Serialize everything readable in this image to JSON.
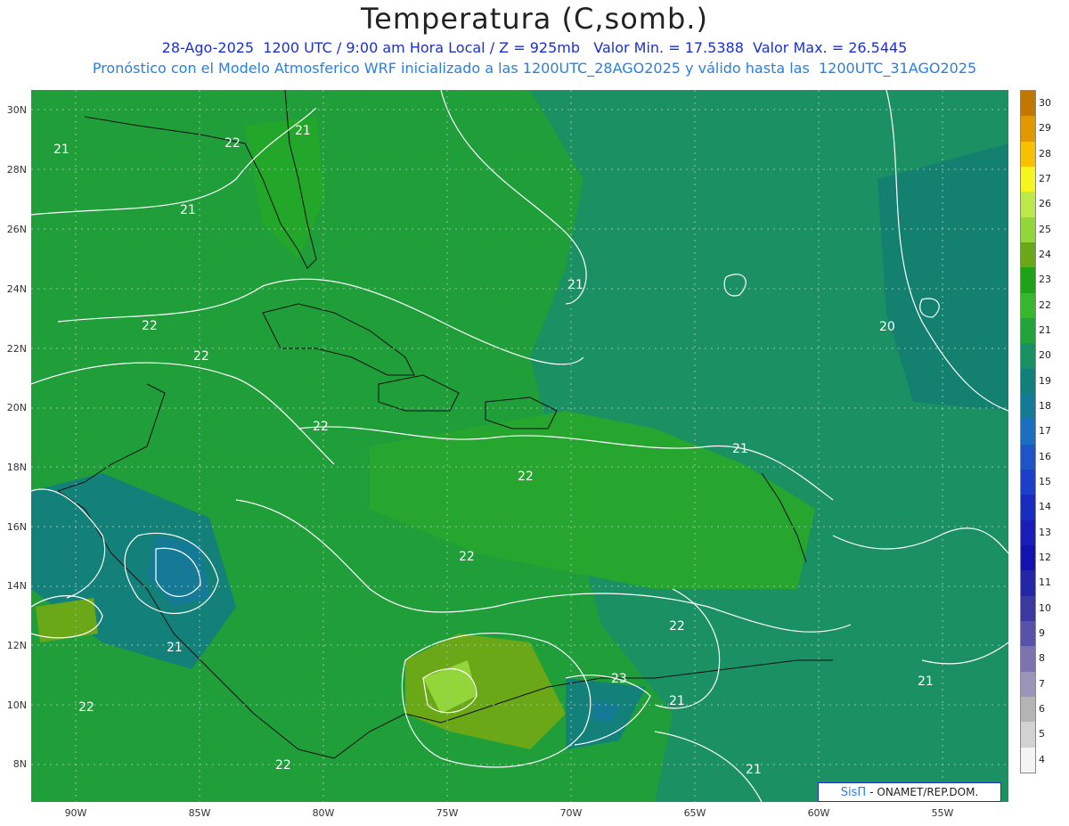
{
  "title": "Temperatura (C,somb.)",
  "subtitle_line1": "28-Ago-2025  1200 UTC / 9:00 am Hora Local / Z = 925mb   Valor Min. = 17.5388  Valor Max. = 26.5445",
  "subtitle_line2": "Pronóstico con el Modelo Atmosferico WRF inicializado a las 1200UTC_28AGO2025 y válido hasta las  1200UTC_31AGO2025",
  "lat_labels": [
    "30N",
    "28N",
    "26N",
    "24N",
    "22N",
    "20N",
    "18N",
    "16N",
    "14N",
    "12N",
    "10N",
    "8N"
  ],
  "lon_labels": [
    "90W",
    "85W",
    "80W",
    "75W",
    "70W",
    "65W",
    "60W",
    "55W"
  ],
  "colorbar": {
    "values": [
      30,
      29,
      28,
      27,
      26,
      25,
      24,
      23,
      22,
      21,
      20,
      19,
      18,
      17,
      16,
      15,
      14,
      13,
      12,
      11,
      10,
      9,
      8,
      7,
      6,
      5,
      4
    ],
    "colors": [
      "#c07800",
      "#e09a00",
      "#f7c000",
      "#f5f520",
      "#bde84a",
      "#93d63a",
      "#6aa817",
      "#1fa316",
      "#37b72b",
      "#22a33b",
      "#1a9065",
      "#11807a",
      "#157a95",
      "#1a6fbf",
      "#1d55c8",
      "#1b3fc8",
      "#1a2bc0",
      "#1a1cb8",
      "#1312ae",
      "#2525a8",
      "#3b38a0",
      "#5853a8",
      "#7c73b0",
      "#9b96b9",
      "#b4b4b4",
      "#d2d2d2",
      "#f4f4f4"
    ]
  },
  "contour_labels": [
    "21",
    "22",
    "21",
    "21",
    "21",
    "22",
    "22",
    "22",
    "20",
    "21",
    "22",
    "22",
    "21",
    "22",
    "23",
    "21",
    "22",
    "22",
    "21",
    "21"
  ],
  "credit": {
    "sispi": "SisΠ",
    "onamet": "- ONAMET/REP.DOM."
  }
}
